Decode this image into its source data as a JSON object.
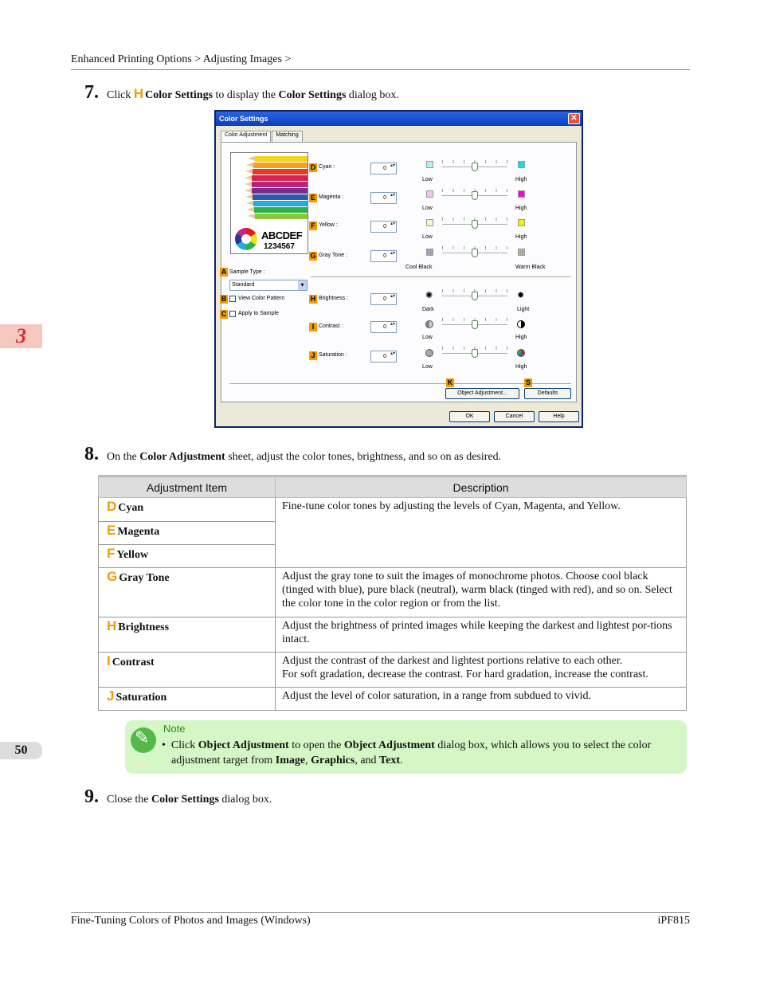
{
  "breadcrumb": "Enhanced Printing Options > Adjusting Images >",
  "chapter": "3",
  "page_number": "50",
  "step7": {
    "num": "7.",
    "pre": "Click",
    "marker": "H",
    "bold1": "Color Settings",
    "mid": "to display the",
    "bold2": "Color Settings",
    "post": "dialog box."
  },
  "dialog": {
    "title": "Color Settings",
    "tabs": [
      "Color Adjustment",
      "Matching"
    ],
    "preview": {
      "text1": "ABCDEF",
      "text2": "1234567"
    },
    "rows": [
      {
        "marker": "D",
        "label": "Cyan :",
        "value": "0",
        "low": "Low",
        "high": "High",
        "low_color": "#b3f2f7",
        "high_color": "#00e5f0"
      },
      {
        "marker": "E",
        "label": "Magenta :",
        "value": "0",
        "low": "Low",
        "high": "High",
        "low_color": "#f7c2ef",
        "high_color": "#ff00e0"
      },
      {
        "marker": "F",
        "label": "Yellow :",
        "value": "0",
        "low": "Low",
        "high": "High",
        "low_color": "#f8f6c2",
        "high_color": "#f7f000"
      },
      {
        "marker": "G",
        "label": "Gray Tone :",
        "value": "0",
        "low": "Cool Black",
        "high": "Warm Black",
        "low_color": "#9ea3b3",
        "high_color": "#b4ad9e"
      },
      {
        "marker": "H",
        "label": "Brightness :",
        "value": "0",
        "low": "Dark",
        "high": "Light"
      },
      {
        "marker": "I",
        "label": "Contrast :",
        "value": "0",
        "low": "Low",
        "high": "High"
      },
      {
        "marker": "J",
        "label": "Saturation :",
        "value": "0",
        "low": "Low",
        "high": "High"
      }
    ],
    "sample_type": {
      "marker": "A",
      "label": "Sample Type :",
      "value": "Standard"
    },
    "view_color_pattern": {
      "marker": "B",
      "label": "View Color Pattern"
    },
    "apply_to_sample": {
      "marker": "C",
      "label": "Apply to Sample"
    },
    "object_adjustment": {
      "marker": "K",
      "label": "Object Adjustment..."
    },
    "defaults": {
      "marker": "S",
      "label": "Defaults"
    },
    "ok": "OK",
    "cancel": "Cancel",
    "help": "Help"
  },
  "step8": {
    "num": "8.",
    "pre": "On the",
    "bold": "Color Adjustment",
    "post": "sheet, adjust the color tones, brightness, and so on as desired."
  },
  "table": {
    "headers": [
      "Adjustment Item",
      "Description"
    ],
    "rows": [
      {
        "marker": "D",
        "item": "Cyan"
      },
      {
        "marker": "E",
        "item": "Magenta"
      },
      {
        "marker": "F",
        "item": "Yellow"
      },
      {
        "marker": "G",
        "item": "Gray Tone"
      },
      {
        "marker": "H",
        "item": "Brightness"
      },
      {
        "marker": "I",
        "item": "Contrast"
      },
      {
        "marker": "J",
        "item": "Saturation"
      }
    ],
    "desc_cmy": "Fine-tune color tones by adjusting the levels of Cyan, Magenta, and Yellow.",
    "desc_gray": "Adjust the gray tone to suit the images of monochrome photos. Choose cool black (tinged with blue), pure black (neutral), warm black (tinged with red), and so on. Select the color tone in the color region or from the list.",
    "desc_brightness": "Adjust the brightness of printed images while keeping the darkest and lightest por-tions intact.",
    "desc_contrast_1": "Adjust the contrast of the darkest and lightest portions relative to each other.",
    "desc_contrast_2": "For soft gradation, decrease the contrast. For hard gradation, increase the contrast.",
    "desc_saturation": "Adjust the level of color saturation, in a range from subdued to vivid."
  },
  "note": {
    "heading": "Note",
    "bullet": "•",
    "t1": "Click",
    "b1": "Object Adjustment",
    "t2": "to open the",
    "b2": "Object Adjustment",
    "t3": "dialog box, which allows you to select the color adjustment target from",
    "b3": "Image",
    "t4": ",",
    "b4": "Graphics",
    "t5": ", and",
    "b5": "Text",
    "t6": "."
  },
  "step9": {
    "num": "9.",
    "pre": "Close the",
    "bold": "Color Settings",
    "post": "dialog box."
  },
  "footer": {
    "left": "Fine-Tuning Colors of Photos and Images (Windows)",
    "right": "iPF815"
  }
}
